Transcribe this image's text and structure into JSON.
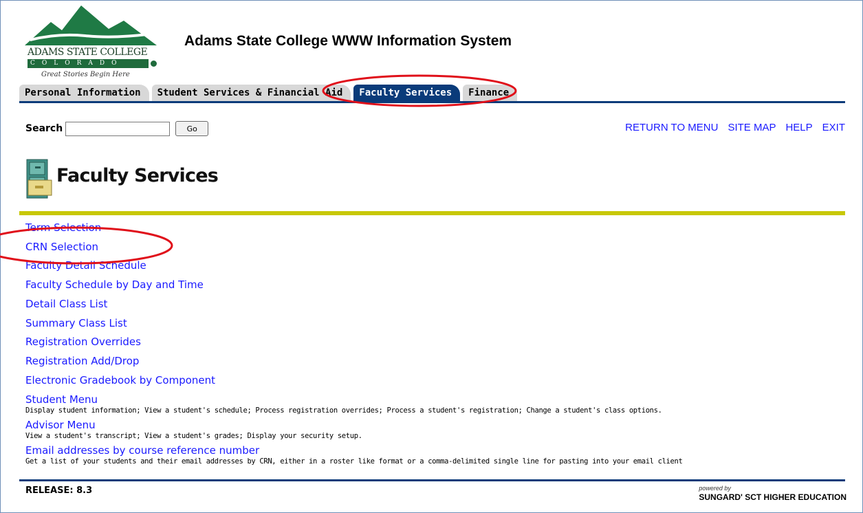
{
  "header": {
    "logo_name": "ADAMS STATE COLLEGE",
    "logo_subtitle": "COLORADO",
    "logo_tagline": "Great Stories Begin Here",
    "title": "Adams State College WWW Information System"
  },
  "tabs": [
    {
      "label": "Personal Information",
      "active": false
    },
    {
      "label": "Student Services & Financial Aid",
      "active": false
    },
    {
      "label": "Faculty Services",
      "active": true
    },
    {
      "label": "Finance",
      "active": false
    }
  ],
  "search": {
    "label": "Search",
    "value": "",
    "button": "Go"
  },
  "toplinks": [
    "RETURN TO MENU",
    "SITE MAP",
    "HELP",
    "EXIT"
  ],
  "page": {
    "title": "Faculty Services",
    "icon": "file-cabinet-icon"
  },
  "menu": [
    {
      "label": "Term Selection",
      "desc": ""
    },
    {
      "label": "CRN Selection",
      "desc": ""
    },
    {
      "label": "Faculty Detail Schedule",
      "desc": ""
    },
    {
      "label": "Faculty Schedule by Day and Time",
      "desc": ""
    },
    {
      "label": "Detail Class List",
      "desc": ""
    },
    {
      "label": "Summary Class List",
      "desc": ""
    },
    {
      "label": "Registration Overrides",
      "desc": ""
    },
    {
      "label": "Registration Add/Drop",
      "desc": ""
    },
    {
      "label": "Electronic Gradebook by Component",
      "desc": ""
    },
    {
      "label": "Student Menu",
      "desc": "Display student information; View a student's schedule; Process registration overrides; Process a student's registration; Change a student's class options."
    },
    {
      "label": "Advisor Menu",
      "desc": "View a student's transcript; View a student's grades; Display your security setup."
    },
    {
      "label": "Email addresses by course reference number",
      "desc": "Get a list of your students and their email addresses by CRN, either in a roster like format or a comma-delimited single line for pasting into your email client"
    }
  ],
  "footer": {
    "release": "RELEASE: 8.3",
    "powered_by": "powered by",
    "brand": "SUNGARD' SCT HIGHER EDUCATION"
  },
  "colors": {
    "tab_active": "#0a3b7a",
    "link": "#1a1aff",
    "accent_bar": "#c8c808",
    "annotation": "#e0101a",
    "logo_green": "#1f6b3c"
  }
}
